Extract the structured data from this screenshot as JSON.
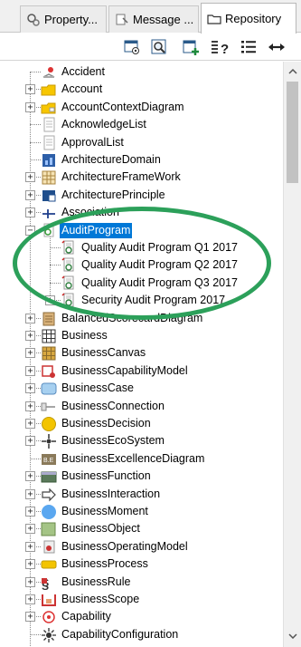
{
  "tabs": [
    {
      "label": "Property...",
      "icon": "properties-icon",
      "active": false
    },
    {
      "label": "Message ...",
      "icon": "message-icon",
      "active": false
    },
    {
      "label": "Repository",
      "icon": "folder-icon",
      "active": true
    }
  ],
  "toolbar": {
    "buttons": [
      "repository-settings-icon",
      "find-icon",
      "new-element-icon",
      "list-help-icon",
      "list-icon",
      "expand-width-icon"
    ]
  },
  "tree": {
    "items": [
      {
        "label": "Accident",
        "icon": "accident-icon",
        "level": 0,
        "expander": "none"
      },
      {
        "label": "Account",
        "icon": "account-folder-icon",
        "level": 0,
        "expander": "plus"
      },
      {
        "label": "AccountContextDiagram",
        "icon": "diagram-folder-icon",
        "level": 0,
        "expander": "plus"
      },
      {
        "label": "AcknowledgeList",
        "icon": "list-doc-icon",
        "level": 0,
        "expander": "none"
      },
      {
        "label": "ApprovalList",
        "icon": "list-doc-icon",
        "level": 0,
        "expander": "none"
      },
      {
        "label": "ArchitectureDomain",
        "icon": "architecture-domain-icon",
        "level": 0,
        "expander": "none"
      },
      {
        "label": "ArchitectureFrameWork",
        "icon": "framework-grid-icon",
        "level": 0,
        "expander": "plus"
      },
      {
        "label": "ArchitecturePrinciple",
        "icon": "principle-icon",
        "level": 0,
        "expander": "plus"
      },
      {
        "label": "Association",
        "icon": "association-icon",
        "level": 0,
        "expander": "plus"
      },
      {
        "label": "AuditProgram",
        "icon": "audit-program-icon",
        "level": 0,
        "expander": "minus",
        "selected": true
      },
      {
        "label": "Quality Audit Program Q1 2017",
        "icon": "audit-doc-icon",
        "level": 1,
        "expander": "none"
      },
      {
        "label": "Quality Audit Program Q2 2017",
        "icon": "audit-doc-icon",
        "level": 1,
        "expander": "none"
      },
      {
        "label": "Quality Audit Program Q3 2017",
        "icon": "audit-doc-icon",
        "level": 1,
        "expander": "none"
      },
      {
        "label": "Security Audit Program 2017",
        "icon": "audit-doc-icon",
        "level": 1,
        "expander": "plus"
      },
      {
        "label": "BalancedScorecardDiagram",
        "icon": "scorecard-icon",
        "level": 0,
        "expander": "plus"
      },
      {
        "label": "Business",
        "icon": "business-grid-icon",
        "level": 0,
        "expander": "plus"
      },
      {
        "label": "BusinessCanvas",
        "icon": "canvas-icon",
        "level": 0,
        "expander": "plus"
      },
      {
        "label": "BusinessCapabilityModel",
        "icon": "capability-model-icon",
        "level": 0,
        "expander": "plus"
      },
      {
        "label": "BusinessCase",
        "icon": "business-case-icon",
        "level": 0,
        "expander": "plus"
      },
      {
        "label": "BusinessConnection",
        "icon": "connection-icon",
        "level": 0,
        "expander": "plus"
      },
      {
        "label": "BusinessDecision",
        "icon": "decision-icon",
        "level": 0,
        "expander": "plus"
      },
      {
        "label": "BusinessEcoSystem",
        "icon": "ecosystem-icon",
        "level": 0,
        "expander": "plus"
      },
      {
        "label": "BusinessExcellenceDiagram",
        "icon": "excellence-diagram-icon",
        "level": 0,
        "expander": "none"
      },
      {
        "label": "BusinessFunction",
        "icon": "function-icon",
        "level": 0,
        "expander": "plus"
      },
      {
        "label": "BusinessInteraction",
        "icon": "interaction-arrow-icon",
        "level": 0,
        "expander": "plus"
      },
      {
        "label": "BusinessMoment",
        "icon": "moment-icon",
        "level": 0,
        "expander": "plus"
      },
      {
        "label": "BusinessObject",
        "icon": "object-icon",
        "level": 0,
        "expander": "plus"
      },
      {
        "label": "BusinessOperatingModel",
        "icon": "operating-model-icon",
        "level": 0,
        "expander": "plus"
      },
      {
        "label": "BusinessProcess",
        "icon": "process-icon",
        "level": 0,
        "expander": "plus"
      },
      {
        "label": "BusinessRule",
        "icon": "rule-icon",
        "level": 0,
        "expander": "plus"
      },
      {
        "label": "BusinessScope",
        "icon": "scope-icon",
        "level": 0,
        "expander": "plus"
      },
      {
        "label": "Capability",
        "icon": "capability-icon",
        "level": 0,
        "expander": "plus"
      },
      {
        "label": "CapabilityConfiguration",
        "icon": "configuration-icon",
        "level": 0,
        "expander": "none"
      }
    ]
  },
  "highlight": {
    "color": "#2ca05a",
    "target": "AuditProgram children"
  },
  "colors": {
    "selection": "#0078d7",
    "tabbar": "#f0f0f0"
  }
}
